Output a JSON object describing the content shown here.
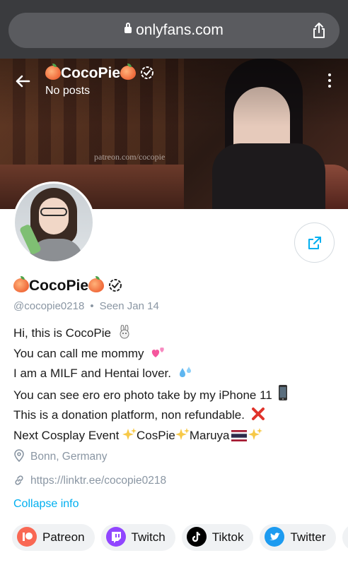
{
  "browser": {
    "url": "onlyfans.com"
  },
  "profile": {
    "header_name": "CocoPie",
    "header_subtitle": "No posts",
    "cover_watermark": "patreon.com/cocopie",
    "display_name": "CocoPie",
    "handle": "@cocopie0218",
    "separator": "•",
    "last_seen": "Seen Jan 14",
    "bio": [
      "Hi, this is CocoPie",
      "You can call me mommy",
      "I am a MILF and Hentai lover.",
      "You can see ero ero photo take by my iPhone 11",
      "This is a donation platform, non refundable.",
      "Next Cosplay Event ",
      "CosPie",
      "Maruya"
    ],
    "location": "Bonn, Germany",
    "website": "https://linktr.ee/cocopie0218",
    "collapse_label": "Collapse info"
  },
  "socials": [
    {
      "label": "Patreon",
      "icon": "patreon-icon",
      "color": "#f96854"
    },
    {
      "label": "Twitch",
      "icon": "twitch-icon",
      "color": "#9146ff"
    },
    {
      "label": "Tiktok",
      "icon": "tiktok-icon",
      "color": "#000000"
    },
    {
      "label": "Twitter",
      "icon": "twitter-icon",
      "color": "#1d9bf0"
    }
  ],
  "colors": {
    "accent": "#00aff0",
    "muted_text": "#8a96a3",
    "chip_bg": "#f0f2f4"
  }
}
